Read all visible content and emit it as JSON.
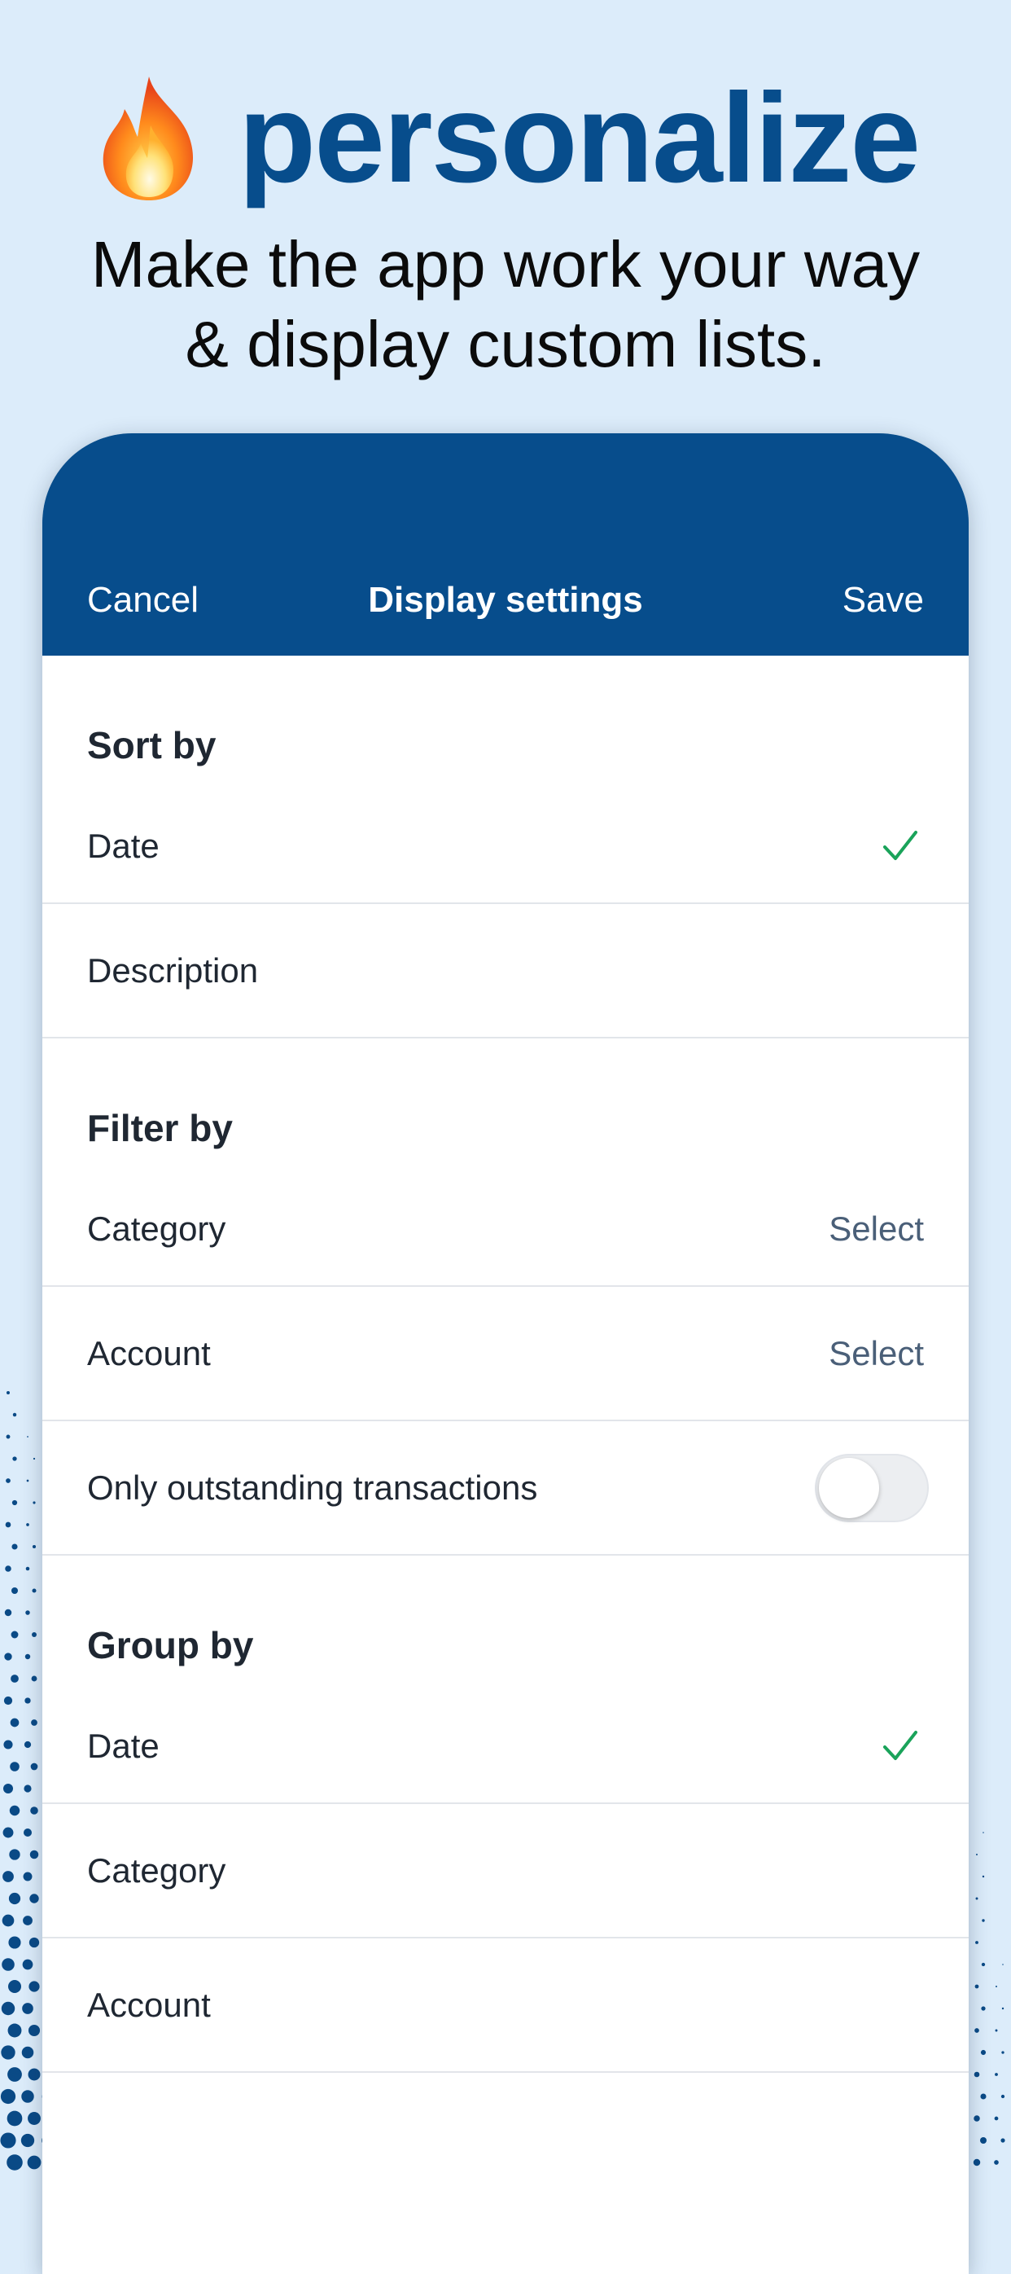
{
  "hero": {
    "title": "personalize",
    "subtitle_line1": "Make the app work your way",
    "subtitle_line2": "& display custom lists.",
    "icon": "fire-icon"
  },
  "colors": {
    "brand_blue": "#074d8c",
    "background": "#dcecfa",
    "check_green": "#1aa35a",
    "select_text": "#4a5f78"
  },
  "header": {
    "cancel_label": "Cancel",
    "title": "Display settings",
    "save_label": "Save"
  },
  "sort": {
    "heading": "Sort by",
    "options": [
      {
        "label": "Date",
        "selected": true
      },
      {
        "label": "Description",
        "selected": false
      }
    ]
  },
  "filter": {
    "heading": "Filter by",
    "category_label": "Category",
    "category_value": "Select",
    "account_label": "Account",
    "account_value": "Select",
    "outstanding_label": "Only outstanding transactions",
    "outstanding_on": false
  },
  "group": {
    "heading": "Group by",
    "options": [
      {
        "label": "Date",
        "selected": true
      },
      {
        "label": "Category",
        "selected": false
      },
      {
        "label": "Account",
        "selected": false
      }
    ]
  }
}
